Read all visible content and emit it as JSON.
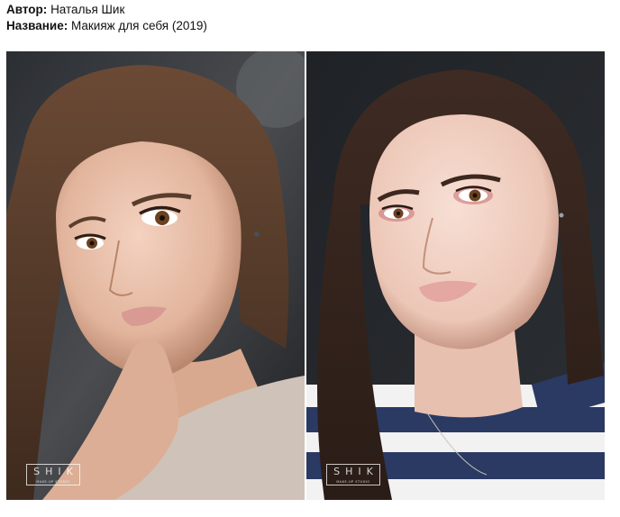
{
  "meta": {
    "author_label": "Автор:",
    "author_value": "Наталья Шик",
    "title_label": "Название:",
    "title_value": "Макияж для себя (2019)"
  },
  "photos": [
    {
      "watermark": "SHIK",
      "watermark_sub": "MAKE-UP STUDIO"
    },
    {
      "watermark": "SHIK",
      "watermark_sub": "MAKE-UP STUDIO"
    }
  ]
}
